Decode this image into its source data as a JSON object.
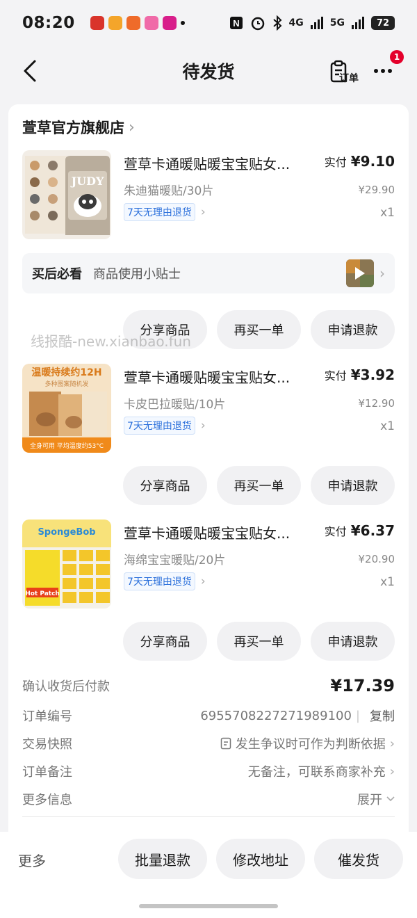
{
  "status_bar": {
    "time": "08:20",
    "network": "4G",
    "network2": "5G",
    "battery": "72"
  },
  "nav": {
    "title": "待发货",
    "order_label": "订单",
    "badge_count": "1"
  },
  "shop": {
    "name": "萱草官方旗舰店"
  },
  "items": [
    {
      "title": "萱草卡通暖贴暖宝宝贴女...",
      "spec": "朱迪猫暖贴/30片",
      "return_tag": "7天无理由退货",
      "paid_label": "实付",
      "paid": "¥9.10",
      "original": "¥29.90",
      "qty": "x1",
      "thumb_text": "JUDY",
      "thumb_icon": "cat-heat-patch-image"
    },
    {
      "title": "萱草卡通暖贴暖宝宝贴女...",
      "spec": "卡皮巴拉暖贴/10片",
      "return_tag": "7天无理由退货",
      "paid_label": "实付",
      "paid": "¥3.92",
      "original": "¥12.90",
      "qty": "x1",
      "thumb_text": "温暖持续约12H",
      "thumb_sub": "多种图案随机发",
      "thumb_bottom": "全身可用 平均温度约53°C",
      "thumb_icon": "capybara-heat-patch-image"
    },
    {
      "title": "萱草卡通暖贴暖宝宝贴女...",
      "spec": "海绵宝宝暖贴/20片",
      "return_tag": "7天无理由退货",
      "paid_label": "实付",
      "paid": "¥6.37",
      "original": "¥20.90",
      "qty": "x1",
      "thumb_text": "SpongeBob",
      "thumb_sub": "Hot Patch",
      "thumb_icon": "spongebob-heat-patch-image"
    }
  ],
  "tips": {
    "title": "买后必看",
    "text": "商品使用小贴士"
  },
  "item_buttons": {
    "share": "分享商品",
    "rebuy": "再买一单",
    "refund": "申请退款"
  },
  "watermark": "线报酷-new.xianbao.fun",
  "order_info": {
    "total_label": "确认收货后付款",
    "total": "¥17.39",
    "order_no_label": "订单编号",
    "order_no": "6955708227271989100",
    "copy": "复制",
    "snapshot_label": "交易快照",
    "snapshot_value": "发生争议时可作为判断依据",
    "note_label": "订单备注",
    "note_value": "无备注，可联系商家补充",
    "more_label": "更多信息",
    "expand": "展开"
  },
  "bottom_bar": {
    "more": "更多",
    "batch_refund": "批量退款",
    "change_address": "修改地址",
    "urge_ship": "催发货"
  },
  "colors": {
    "badge": "#e4002b",
    "return_tag": "#2a6fdb",
    "background": "#f3f3f5"
  }
}
